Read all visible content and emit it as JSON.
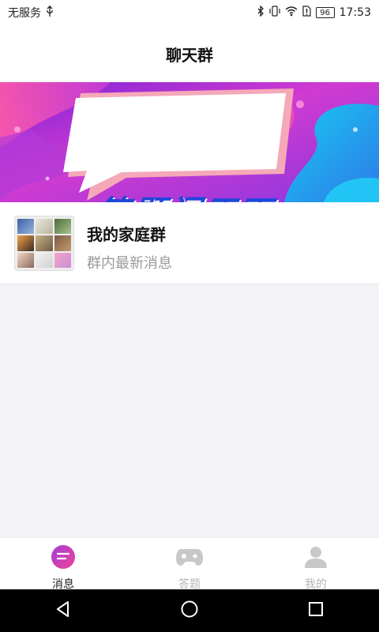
{
  "status_bar": {
    "carrier": "无服务",
    "battery": "96",
    "time": "17:53"
  },
  "header": {
    "title": "聊天群"
  },
  "banner": {
    "title": "答题闯天下",
    "slide_count": 2,
    "active_slide": 2
  },
  "chat_list": [
    {
      "name": "我的家庭群",
      "preview": "群内最新消息"
    }
  ],
  "tabbar": {
    "items": [
      {
        "label": "消息",
        "icon": "message-icon",
        "active": true
      },
      {
        "label": "答题",
        "icon": "gamepad-icon",
        "active": false
      },
      {
        "label": "我的",
        "icon": "profile-icon",
        "active": false
      }
    ]
  },
  "colors": {
    "accent": "#e0418e",
    "banner_blue": "#1d47d9",
    "inactive": "#c8c8c8"
  }
}
